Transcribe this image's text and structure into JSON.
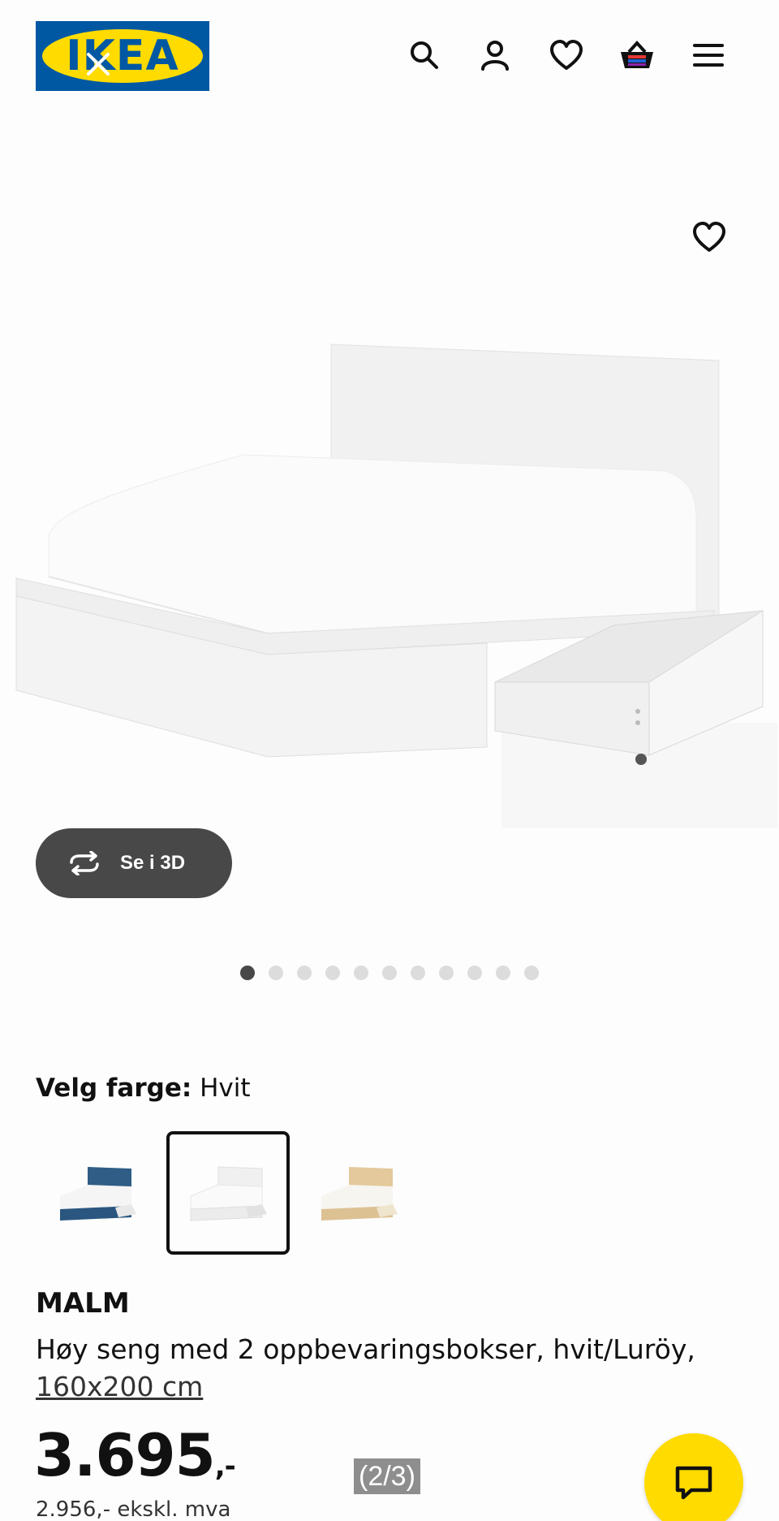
{
  "header": {
    "logo_text": "IKEA",
    "icons": [
      "search-icon",
      "account-icon",
      "heart-icon",
      "basket-icon",
      "menu-icon"
    ]
  },
  "gallery": {
    "view_3d_label": "Se i 3D",
    "slide_count": 11,
    "active_slide": 1
  },
  "color_picker": {
    "label": "Velg farge:",
    "value": "Hvit",
    "options": [
      "blue",
      "white",
      "oak"
    ],
    "selected": "white"
  },
  "product": {
    "name": "MALM",
    "description": "Høy seng med 2 oppbevaringsbokser, hvit/Luröy,",
    "size": "160x200 cm",
    "price": "3.695",
    "price_suffix": ",-",
    "price_ex_vat": "2.956,- ekskl. mva"
  },
  "page_indicator": "(2/3)",
  "colors": {
    "brand_blue": "#0058a3",
    "brand_yellow": "#ffdb00",
    "button_dark": "#484848"
  }
}
